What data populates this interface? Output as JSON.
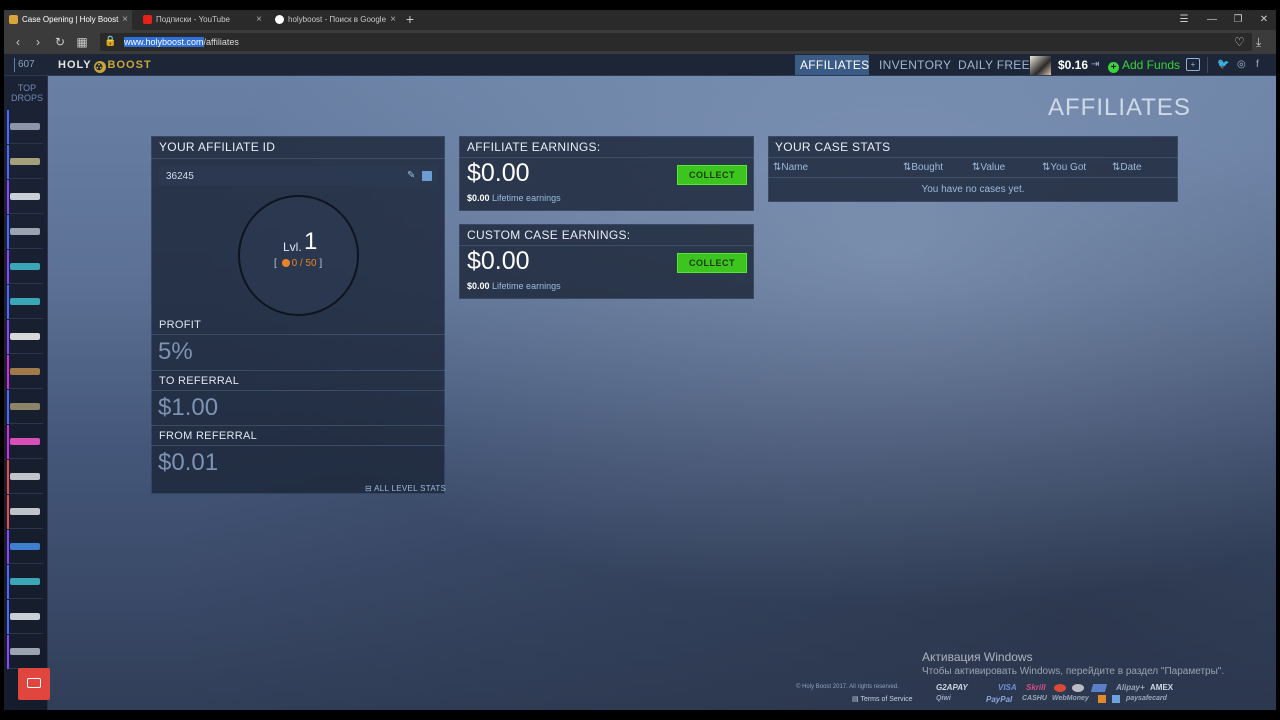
{
  "browser": {
    "tabs": [
      {
        "title": "Case Opening | Holy Boost",
        "close": "×"
      },
      {
        "title": "Подписки - YouTube",
        "close": "×"
      },
      {
        "title": "holyboost - Поиск в Google",
        "close": "×"
      }
    ],
    "new_tab": "+",
    "url_selected": "www.holyboost.com",
    "url_path": "/affiliates"
  },
  "header": {
    "online_count": "607",
    "logo_left": "HOLY",
    "logo_right": "BOOST",
    "nav": [
      "AFFILIATES",
      "INVENTORY",
      "DAILY FREE"
    ],
    "balance": "$0.16",
    "add_funds": "Add Funds"
  },
  "sidebar": {
    "top_drops": "TOP DROPS"
  },
  "page_title": "AFFILIATES",
  "affiliate_panel": {
    "title": "YOUR AFFILIATE ID",
    "affiliate_id": "36245",
    "level_label": "Lvl.",
    "level": "1",
    "progress_open": "[",
    "progress": "0 / 50",
    "progress_close": "]",
    "profit_label": "PROFIT",
    "profit_value": "5%",
    "to_referral_label": "TO REFERRAL",
    "to_referral_value": "$1.00",
    "from_referral_label": "FROM REFERRAL",
    "from_referral_value": "$0.01",
    "all_level_stats": "ALL LEVEL STATS"
  },
  "affiliate_earnings": {
    "title": "AFFILIATE EARNINGS:",
    "amount": "$0.00",
    "lifetime_amount": "$0.00",
    "lifetime_label": "Lifetime earnings",
    "button": "COLLECT"
  },
  "custom_case_earnings": {
    "title": "CUSTOM CASE EARNINGS:",
    "amount": "$0.00",
    "lifetime_amount": "$0.00",
    "lifetime_label": "Lifetime earnings",
    "button": "COLLECT"
  },
  "case_stats": {
    "title": "YOUR CASE STATS",
    "columns": [
      "Name",
      "Bought",
      "Value",
      "You Got",
      "Date"
    ],
    "empty_message": "You have no cases yet."
  },
  "windows_activation": {
    "title": "Активация Windows",
    "subtitle": "Чтобы активировать Windows, перейдите в раздел \"Параметры\"."
  },
  "footer": {
    "copyright": "© Holy Boost 2017. All rights reserved.",
    "terms": "Terms of Service",
    "payments_row1": [
      "G2APAY",
      "VISA",
      "Skrill",
      "Alipay+",
      "AMEX"
    ],
    "payments_row2": [
      "Qiwi",
      "PayPal",
      "CASHU",
      "WebMoney",
      "paysafecard"
    ]
  },
  "colors": {
    "accent_blue": "#3a5b86",
    "collect_green": "#3cc51f",
    "add_funds_green": "#3ad33a",
    "chat_red": "#e0463e"
  }
}
